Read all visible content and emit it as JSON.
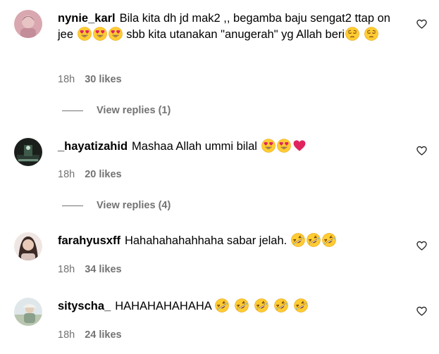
{
  "comments": [
    {
      "username": "nynie_karl",
      "text_1": "Bila kita dh jd mak2 ,, begamba baju sengat2 ttap on jee",
      "text_2": "sbb kita utanakan \"anugerah\" yg Allah beri",
      "time": "18h",
      "likes": "30 likes",
      "replies": "View replies (1)"
    },
    {
      "username": "_hayatizahid",
      "text": "Mashaa Allah ummi bilal",
      "time": "18h",
      "likes": "20 likes",
      "replies": "View replies (4)"
    },
    {
      "username": "farahyusxff",
      "text": "Hahahahahahhaha sabar jelah.",
      "time": "18h",
      "likes": "34 likes"
    },
    {
      "username": "sityscha_",
      "text": "HAHAHAHAHAHA",
      "time": "18h",
      "likes": "24 likes"
    }
  ],
  "colors": {
    "text": "#000000",
    "secondary": "#737373",
    "background": "#ffffff",
    "heart": "#e0245e"
  },
  "icons": {
    "like": "heart-outline-icon",
    "heart_eyes": "heart-eyes-emoji",
    "pensive": "pensive-emoji",
    "red_heart": "red-heart-emoji",
    "rofl": "rofl-emoji"
  }
}
